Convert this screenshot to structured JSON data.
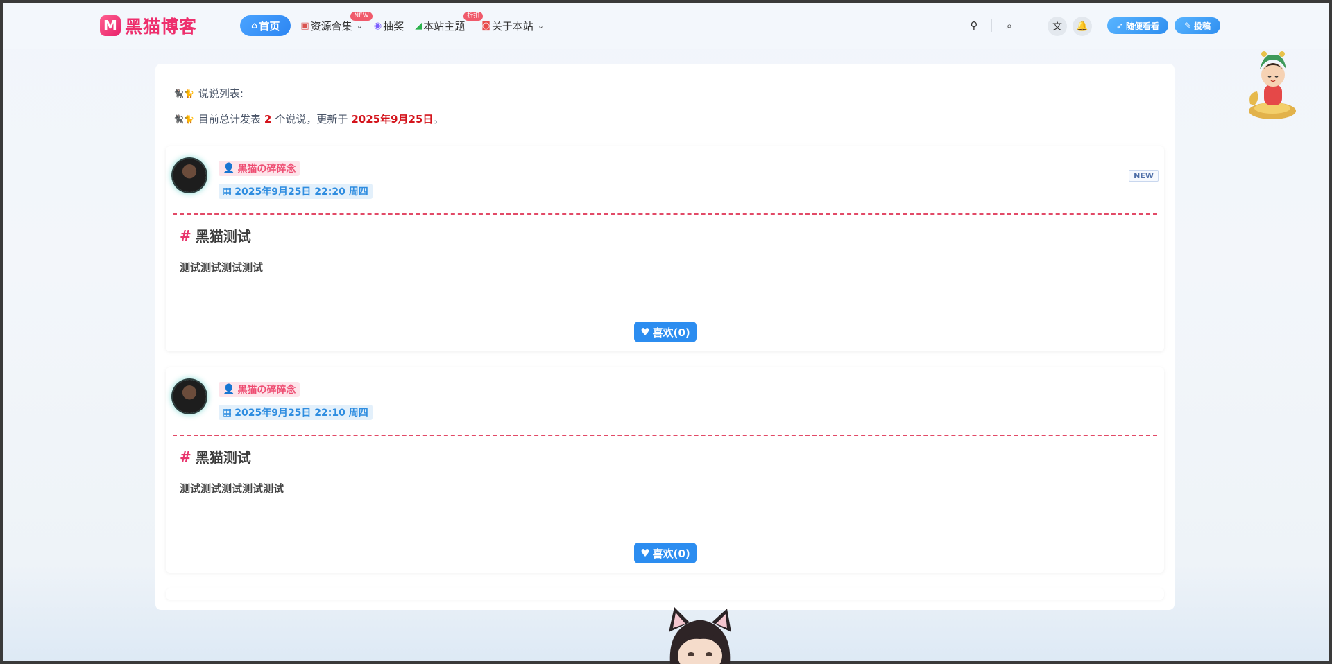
{
  "brand": {
    "logo_letter": "M",
    "name": "黑猫博客"
  },
  "nav": {
    "items": [
      {
        "icon": "home-icon",
        "label": "首页",
        "active": true
      },
      {
        "icon": "gift-icon",
        "label": "资源合集",
        "tag": "NEW",
        "dropdown": true
      },
      {
        "icon": "lottery-icon",
        "label": "抽奖"
      },
      {
        "icon": "theme-icon",
        "label": "本站主题",
        "tag": "折扣"
      },
      {
        "icon": "about-icon",
        "label": "关于本站",
        "dropdown": true
      }
    ],
    "random_label": "随便看看",
    "submit_label": "投稿"
  },
  "intro": {
    "emoji": "🐈‍⬛🐈",
    "title": "说说列表:",
    "prefix": "目前总计发表",
    "count": "2",
    "middle": "个说说，更新于",
    "date": "2025年9月25日",
    "suffix": "。"
  },
  "posts": [
    {
      "author": "黑猫の碎碎念",
      "datetime": "2025年9月25日 22:20 周四",
      "badge": "NEW",
      "title": "黑猫测试",
      "body": "测试测试测试测试",
      "like": "喜欢(0)"
    },
    {
      "author": "黑猫の碎碎念",
      "datetime": "2025年9月25日 22:10 周四",
      "title": "黑猫测试",
      "body": "测试测试测试测试测试",
      "like": "喜欢(0)"
    }
  ],
  "colors": {
    "brand_pink": "#ee2f6d",
    "accent_blue": "#2c8df0",
    "highlight_red": "#d4141c"
  }
}
